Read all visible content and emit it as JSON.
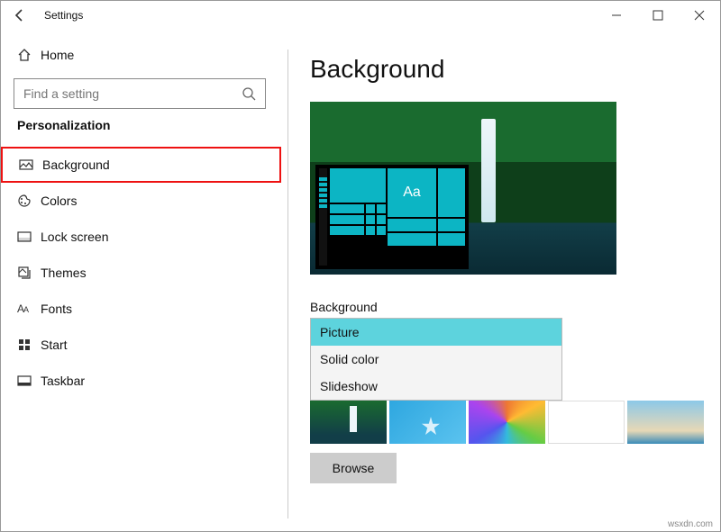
{
  "window": {
    "title": "Settings"
  },
  "sidebar": {
    "home_label": "Home",
    "search_placeholder": "Find a setting",
    "section": "Personalization",
    "items": [
      {
        "label": "Background",
        "icon": "picture-icon",
        "selected": true
      },
      {
        "label": "Colors",
        "icon": "palette-icon"
      },
      {
        "label": "Lock screen",
        "icon": "lockscreen-icon"
      },
      {
        "label": "Themes",
        "icon": "themes-icon"
      },
      {
        "label": "Fonts",
        "icon": "fonts-icon"
      },
      {
        "label": "Start",
        "icon": "start-icon"
      },
      {
        "label": "Taskbar",
        "icon": "taskbar-icon"
      }
    ]
  },
  "main": {
    "title": "Background",
    "preview_sample_text": "Aa",
    "field_label": "Background",
    "dropdown": {
      "options": [
        "Picture",
        "Solid color",
        "Slideshow"
      ],
      "selected": "Picture"
    },
    "browse_label": "Browse"
  },
  "watermark": "wsxdn.com"
}
